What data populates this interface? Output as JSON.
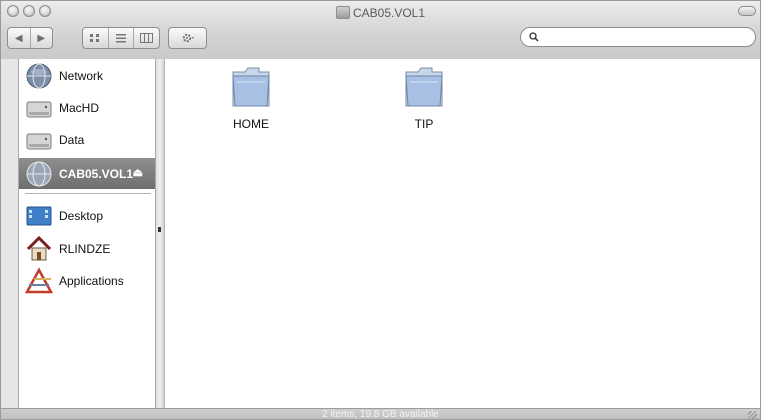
{
  "window": {
    "title": "CAB05.VOL1",
    "status_text": "2 items, 19.8 GB available"
  },
  "toolbar": {
    "back_icon": "back-arrow-icon",
    "forward_icon": "forward-arrow-icon",
    "view_icons": [
      "icon-view-icon",
      "list-view-icon",
      "column-view-icon"
    ],
    "action_icon": "gear-icon",
    "search": {
      "value": "",
      "placeholder": ""
    }
  },
  "sidebar": {
    "devices": [
      {
        "label": "Network",
        "icon": "network-globe-icon",
        "selected": false
      },
      {
        "label": "MacHD",
        "icon": "hard-drive-icon",
        "selected": false
      },
      {
        "label": "Data",
        "icon": "hard-drive-icon",
        "selected": false
      },
      {
        "label": "CAB05.VOL1",
        "icon": "network-volume-icon",
        "selected": true,
        "eject": true
      }
    ],
    "places": [
      {
        "label": "Desktop",
        "icon": "desktop-icon"
      },
      {
        "label": "RLINDZE",
        "icon": "home-icon"
      },
      {
        "label": "Applications",
        "icon": "applications-icon"
      }
    ]
  },
  "content": {
    "items": [
      {
        "name": "HOME",
        "icon": "folder-icon"
      },
      {
        "name": "TIP",
        "icon": "folder-icon"
      }
    ]
  },
  "colors": {
    "selection": "#7f7f7f",
    "folder_blue": "#a9c3e6"
  }
}
